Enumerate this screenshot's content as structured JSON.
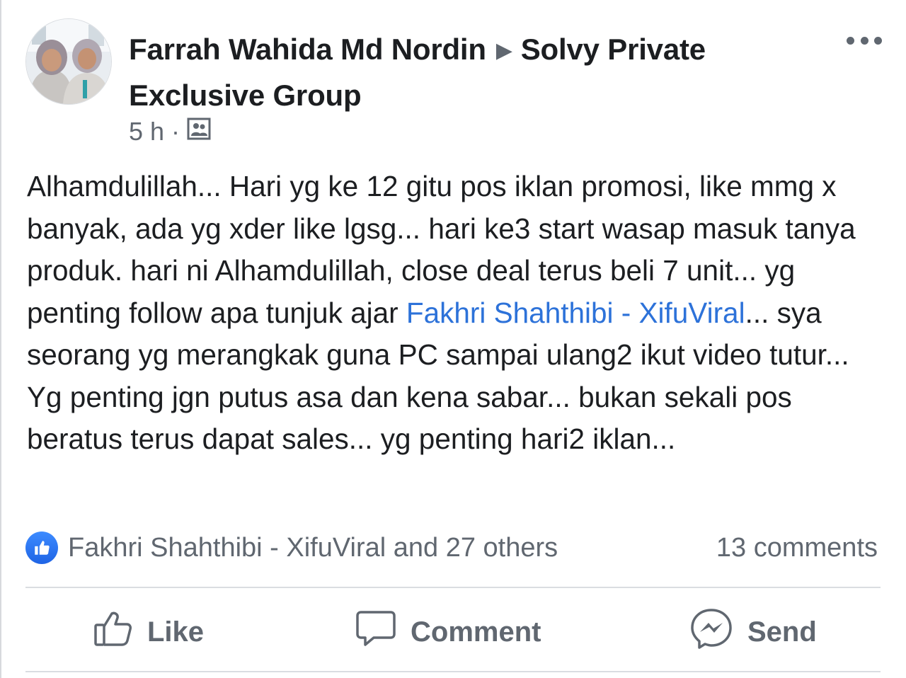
{
  "post": {
    "author": "Farrah Wahida Md Nordin",
    "group": "Solvy Private Exclusive Group",
    "time": "5 h",
    "separator": "·",
    "audience_icon": "group-audience-icon",
    "body": {
      "part1": "Alhamdulillah... Hari yg ke 12 gitu pos iklan promosi, like mmg x banyak, ada yg xder like lgsg... hari ke3 start wasap masuk tanya produk. hari ni Alhamdulillah, close deal terus beli 7 unit... yg penting follow apa tunjuk ajar ",
      "mention": "Fakhri Shahthibi - XifuViral",
      "part2": "... sya seorang yg merangkak guna PC sampai ulang2 ikut video tutur... Yg penting jgn putus asa dan kena sabar... bukan sekali pos beratus terus dapat sales... yg penting hari2 iklan..."
    }
  },
  "reactions": {
    "text": "Fakhri Shahthibi - XifuViral and 27 others",
    "comments": "13 comments"
  },
  "actions": {
    "like": "Like",
    "comment": "Comment",
    "send": "Send"
  },
  "colors": {
    "link": "#2d72d9",
    "muted": "#606770",
    "like_badge": "#1f64e5"
  }
}
